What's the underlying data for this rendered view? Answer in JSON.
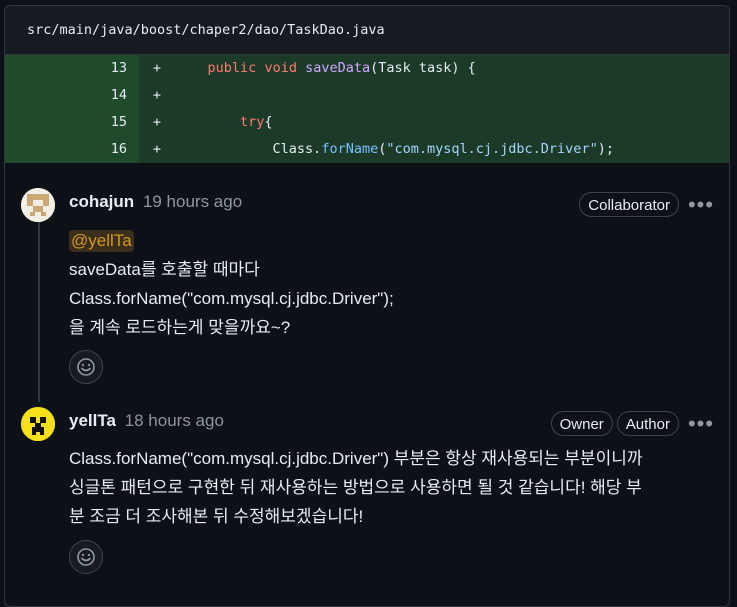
{
  "file": {
    "path": "src/main/java/boost/chaper2/dao/TaskDao.java"
  },
  "diff_lines": [
    {
      "number": "13",
      "sign": "+",
      "indent": "    ",
      "tokens": [
        {
          "t": "public",
          "c": "kw"
        },
        {
          "t": " "
        },
        {
          "t": "void",
          "c": "kw"
        },
        {
          "t": " "
        },
        {
          "t": "saveData",
          "c": "fn"
        },
        {
          "t": "(Task task) {"
        }
      ]
    },
    {
      "number": "14",
      "sign": "+",
      "indent": "",
      "tokens": []
    },
    {
      "number": "15",
      "sign": "+",
      "indent": "        ",
      "tokens": [
        {
          "t": "try",
          "c": "kw"
        },
        {
          "t": "{"
        }
      ]
    },
    {
      "number": "16",
      "sign": "+",
      "indent": "            ",
      "tokens": [
        {
          "t": "Class."
        },
        {
          "t": "forName",
          "c": "mth"
        },
        {
          "t": "("
        },
        {
          "t": "\"com.mysql.cj.jdbc.Driver\"",
          "c": "str"
        },
        {
          "t": ");"
        }
      ]
    }
  ],
  "comments": [
    {
      "author": "cohajun",
      "time": "19 hours ago",
      "badges": [
        "Collaborator"
      ],
      "mention": "@yellTa",
      "lines": [
        "saveData를 호출할 때마다",
        "Class.forName(\"com.mysql.cj.jdbc.Driver\");",
        "을 계속 로드하는게 맞을까요~?"
      ]
    },
    {
      "author": "yellTa",
      "time": "18 hours ago",
      "badges": [
        "Owner",
        "Author"
      ],
      "lines": [
        "Class.forName(\"com.mysql.cj.jdbc.Driver\") 부분은 항상 재사용되는 부분이니까",
        "싱글톤 패턴으로 구현한 뒤 재사용하는 방법으로 사용하면 될 것 같습니다! 해당 부",
        "분 조금 더 조사해본 뒤 수정해보겠습니다!"
      ]
    }
  ],
  "icons": {
    "more": "kebab-horizontal-icon",
    "reaction": "smiley-icon"
  },
  "colors": {
    "added_bg": "#1b3a28",
    "added_num_bg": "#1f4a2c",
    "mention": "#d29922"
  }
}
